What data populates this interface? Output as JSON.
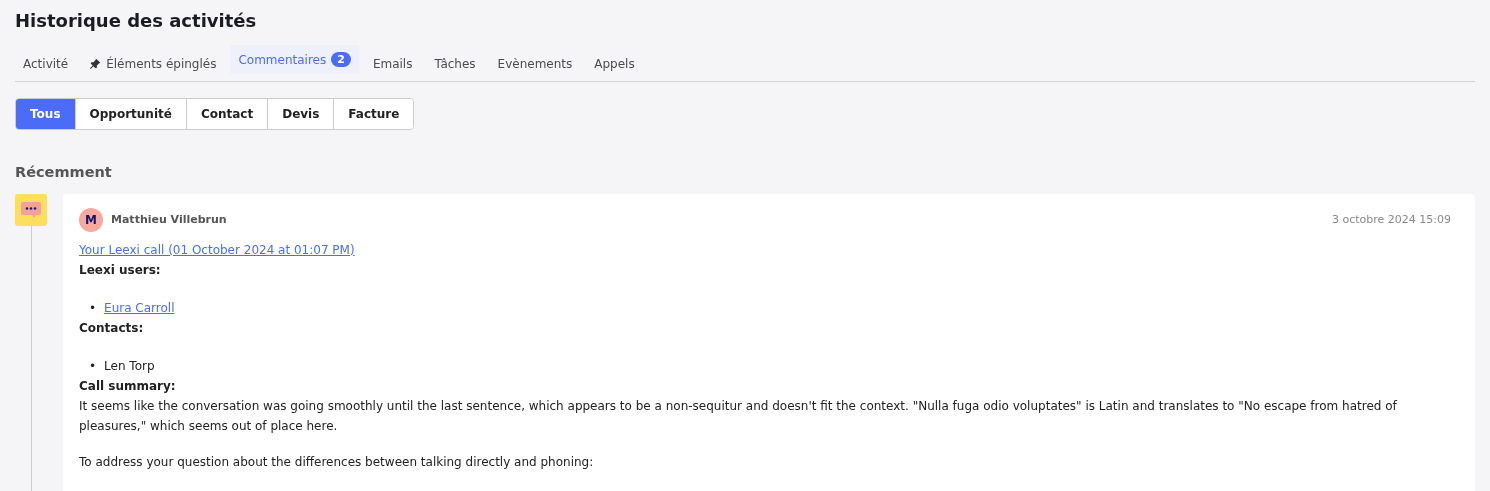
{
  "title": "Historique des activités",
  "tabs": [
    {
      "label": "Activité",
      "selected": false
    },
    {
      "label": "Éléments épinglés",
      "selected": false,
      "kind": "pinned"
    },
    {
      "label": "Commentaires",
      "selected": true,
      "badge": "2"
    },
    {
      "label": "Emails",
      "selected": false
    },
    {
      "label": "Tâches",
      "selected": false
    },
    {
      "label": "Evènements",
      "selected": false
    },
    {
      "label": "Appels",
      "selected": false
    }
  ],
  "filters": [
    {
      "label": "Tous",
      "selected": true
    },
    {
      "label": "Opportunité",
      "selected": false
    },
    {
      "label": "Contact",
      "selected": false
    },
    {
      "label": "Devis",
      "selected": false
    },
    {
      "label": "Facture",
      "selected": false
    }
  ],
  "section_title": "Récemment",
  "entries": [
    {
      "author": {
        "initial": "M",
        "name": "Matthieu Villebrun"
      },
      "date": "3 octobre 2024 15:09",
      "body": [
        {
          "kind": "link",
          "text": "Your Leexi call (01 October 2024 at 01:07 PM)"
        },
        {
          "kind": "heading",
          "text": "Leexi users:"
        },
        {
          "kind": "list",
          "items": [
            {
              "kind": "link",
              "marker": "•",
              "text": "Eura Carroll"
            }
          ]
        },
        {
          "kind": "heading",
          "text": "Contacts:"
        },
        {
          "kind": "list",
          "items": [
            {
              "kind": "text",
              "marker": "•",
              "text": "Len Torp"
            }
          ]
        },
        {
          "kind": "heading",
          "text": "Call summary:"
        },
        {
          "kind": "paragraph",
          "text": "It seems like the conversation was going smoothly until the last sentence, which appears to be a non-sequitur and doesn't fit the context. \"Nulla fuga odio voluptates\" is Latin and translates to \"No escape from hatred of pleasures,\" which seems out of place here."
        },
        {
          "kind": "paragraph",
          "text": "To address your question about the differences between talking directly and phoning:"
        }
      ]
    }
  ]
}
